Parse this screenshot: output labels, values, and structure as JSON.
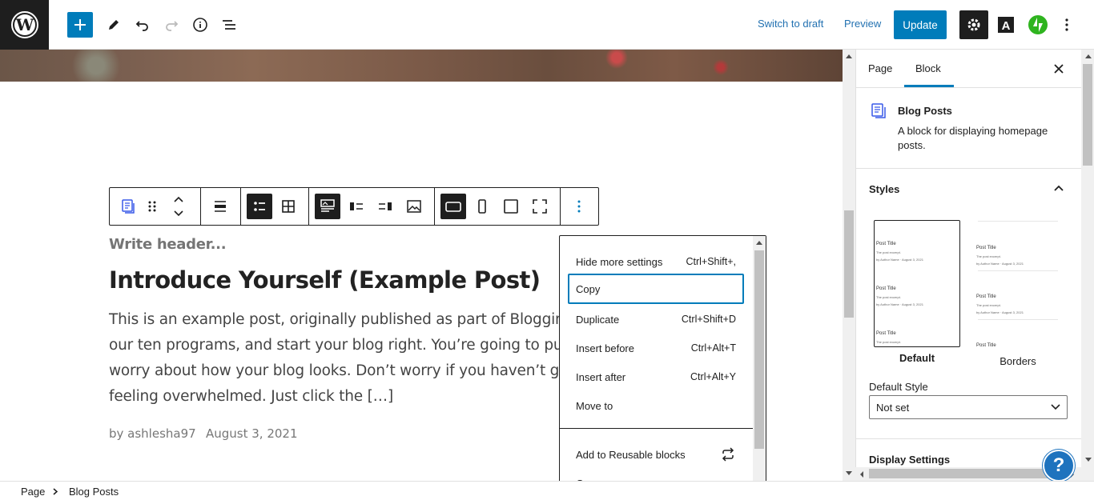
{
  "topbar": {
    "switch_to_draft": "Switch to draft",
    "preview": "Preview",
    "update": "Update",
    "accent": "#007cba"
  },
  "toolbar_icons": [
    "block-type-icon",
    "drag-handle-icon",
    "move-arrows-icon",
    "align-icon",
    "list-view-icon",
    "grid-view-icon",
    "image-top-icon",
    "image-left-icon",
    "image-right-icon",
    "image-only-icon",
    "landscape-icon",
    "portrait-icon",
    "square-icon",
    "fullscreen-icon",
    "more-options-icon"
  ],
  "post": {
    "write_header": "Write header...",
    "title": "Introduce Yourself (Example Post)",
    "excerpt_lines": [
      "This is an example post, originally published as part of Blogging U",
      "our ten programs, and start your blog right. You’re going to publish",
      "worry about how your blog looks. Don’t worry if you haven’t given",
      "feeling overwhelmed. Just click the […]"
    ],
    "author": "by ashlesha97",
    "date": "August 3, 2021"
  },
  "menu": {
    "items": [
      {
        "label": "Hide more settings",
        "shortcut": "Ctrl+Shift+,"
      },
      {
        "label": "Copy",
        "shortcut": ""
      },
      {
        "label": "Duplicate",
        "shortcut": "Ctrl+Shift+D"
      },
      {
        "label": "Insert before",
        "shortcut": "Ctrl+Alt+T"
      },
      {
        "label": "Insert after",
        "shortcut": "Ctrl+Alt+Y"
      },
      {
        "label": "Move to",
        "shortcut": ""
      },
      {
        "label": "Add to Reusable blocks",
        "shortcut": ""
      },
      {
        "label": "Group",
        "shortcut": ""
      }
    ]
  },
  "sidebar": {
    "tabs": [
      "Page",
      "Block"
    ],
    "active_tab": "Block",
    "block_title": "Blog Posts",
    "block_description": "A block for displaying homepage posts.",
    "styles_heading": "Styles",
    "style_options": [
      "Default",
      "Borders"
    ],
    "preview_post_title": "Post Title",
    "preview_excerpt": "The post excerpt.",
    "preview_meta": "by Author Name · August 3, 2021",
    "default_style_label": "Default Style",
    "default_style_value": "Not set",
    "display_settings": "Display Settings"
  },
  "help": "?",
  "breadcrumb": [
    "Page",
    "Blog Posts"
  ]
}
